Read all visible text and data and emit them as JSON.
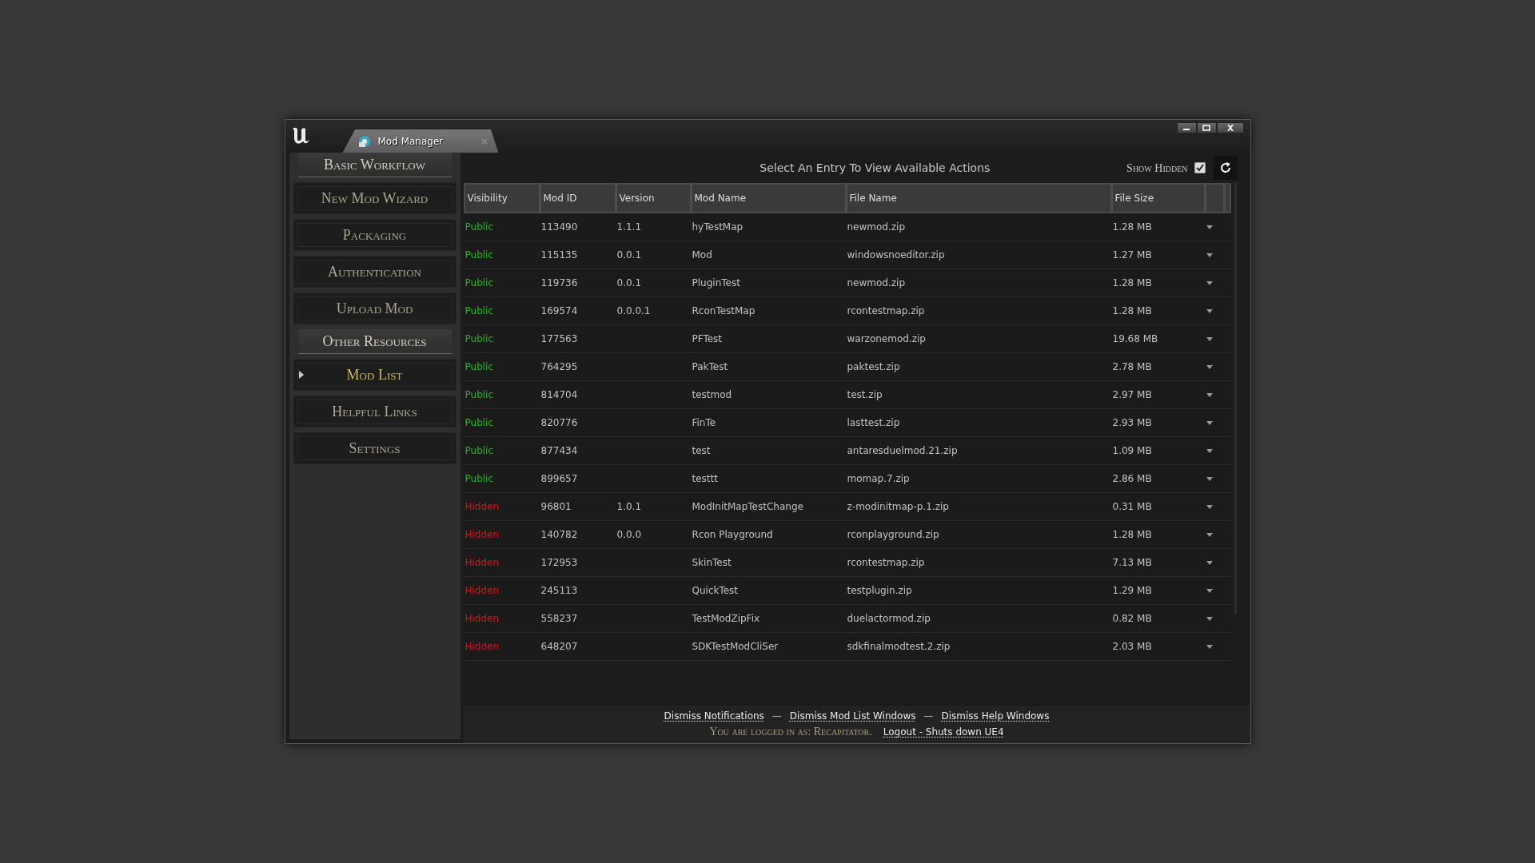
{
  "window": {
    "tab_title": "Mod Manager",
    "tab_close": "×"
  },
  "sidebar": {
    "items": [
      {
        "kind": "heading",
        "label": "Basic Workflow"
      },
      {
        "kind": "button",
        "label": "New Mod Wizard",
        "selected": false
      },
      {
        "kind": "button",
        "label": "Packaging",
        "selected": false
      },
      {
        "kind": "button",
        "label": "Authentication",
        "selected": false
      },
      {
        "kind": "button",
        "label": "Upload Mod",
        "selected": false
      },
      {
        "kind": "heading",
        "label": "Other Resources"
      },
      {
        "kind": "button",
        "label": "Mod List",
        "selected": true
      },
      {
        "kind": "button",
        "label": "Helpful Links",
        "selected": false
      },
      {
        "kind": "button",
        "label": "Settings",
        "selected": false
      }
    ]
  },
  "toolbar": {
    "heading": "Select An Entry To View Available Actions",
    "show_hidden_label": "Show Hidden",
    "show_hidden_checked": true
  },
  "table": {
    "columns": [
      "Visibility",
      "Mod ID",
      "Version",
      "Mod Name",
      "File Name",
      "File Size"
    ],
    "rows": [
      {
        "visibility": "Public",
        "color": "#1fb91f",
        "mod_id": "113490",
        "version": "1.1.1",
        "mod_name": "hyTestMap",
        "file_name": "newmod.zip",
        "file_size": "1.28 MB"
      },
      {
        "visibility": "Public",
        "color": "#1fb91f",
        "mod_id": "115135",
        "version": "0.0.1",
        "mod_name": "Mod",
        "file_name": "windowsnoeditor.zip",
        "file_size": "1.27 MB"
      },
      {
        "visibility": "Public",
        "color": "#1fb91f",
        "mod_id": "119736",
        "version": "0.0.1",
        "mod_name": "PluginTest",
        "file_name": "newmod.zip",
        "file_size": "1.28 MB"
      },
      {
        "visibility": "Public",
        "color": "#1fb91f",
        "mod_id": "169574",
        "version": "0.0.0.1",
        "mod_name": "RconTestMap",
        "file_name": "rcontestmap.zip",
        "file_size": "1.28 MB"
      },
      {
        "visibility": "Public",
        "color": "#1fb91f",
        "mod_id": "177563",
        "mod_name": "PFTest",
        "file_name": "warzonemod.zip",
        "file_size": "19.68 MB"
      },
      {
        "visibility": "Public",
        "color": "#1fb91f",
        "mod_id": "764295",
        "mod_name": "PakTest",
        "file_name": "paktest.zip",
        "file_size": "2.78 MB"
      },
      {
        "visibility": "Public",
        "color": "#1fb91f",
        "mod_id": "814704",
        "mod_name": "testmod",
        "file_name": "test.zip",
        "file_size": "2.97 MB"
      },
      {
        "visibility": "Public",
        "color": "#1fb91f",
        "mod_id": "820776",
        "mod_name": "FinTe",
        "file_name": "lasttest.zip",
        "file_size": "2.93 MB"
      },
      {
        "visibility": "Public",
        "color": "#1fb91f",
        "mod_id": "877434",
        "mod_name": "test",
        "file_name": "antaresduelmod.21.zip",
        "file_size": "1.09 MB"
      },
      {
        "visibility": "Public",
        "color": "#1fb91f",
        "mod_id": "899657",
        "mod_name": "testtt",
        "file_name": "momap.7.zip",
        "file_size": "2.86 MB"
      },
      {
        "visibility": "Hidden",
        "color": "#d01616",
        "mod_id": "96801",
        "version": "1.0.1",
        "mod_name": "ModInitMapTestChange",
        "file_name": "z-modinitmap-p.1.zip",
        "file_size": "0.31 MB"
      },
      {
        "visibility": "Hidden",
        "color": "#d01616",
        "mod_id": "140782",
        "version": "0.0.0",
        "mod_name": "Rcon Playground",
        "file_name": "rconplayground.zip",
        "file_size": "1.28 MB"
      },
      {
        "visibility": "Hidden",
        "color": "#d01616",
        "mod_id": "172953",
        "mod_name": "SkinTest",
        "file_name": "rcontestmap.zip",
        "file_size": "7.13 MB"
      },
      {
        "visibility": "Hidden",
        "color": "#d01616",
        "mod_id": "245113",
        "mod_name": "QuickTest",
        "file_name": "testplugin.zip",
        "file_size": "1.29 MB"
      },
      {
        "visibility": "Hidden",
        "color": "#d01616",
        "mod_id": "558237",
        "mod_name": "TestModZipFix",
        "file_name": "duelactormod.zip",
        "file_size": "0.82 MB"
      },
      {
        "visibility": "Hidden",
        "color": "#d01616",
        "mod_id": "648207",
        "mod_name": "SDKTestModCliSer",
        "file_name": "sdkfinalmodtest.2.zip",
        "file_size": "2.03 MB"
      }
    ]
  },
  "footer": {
    "links": [
      {
        "kind": "link",
        "text": "Dismiss Notifications"
      },
      {
        "kind": "separator",
        "text": "—"
      },
      {
        "kind": "link",
        "text": "Dismiss Mod List Windows"
      },
      {
        "kind": "separator",
        "text": "—"
      },
      {
        "kind": "link",
        "text": "Dismiss Help Windows"
      }
    ],
    "logged_in": "You are logged in as: Recapitator.",
    "logout": "Logout - Shuts down UE4"
  }
}
